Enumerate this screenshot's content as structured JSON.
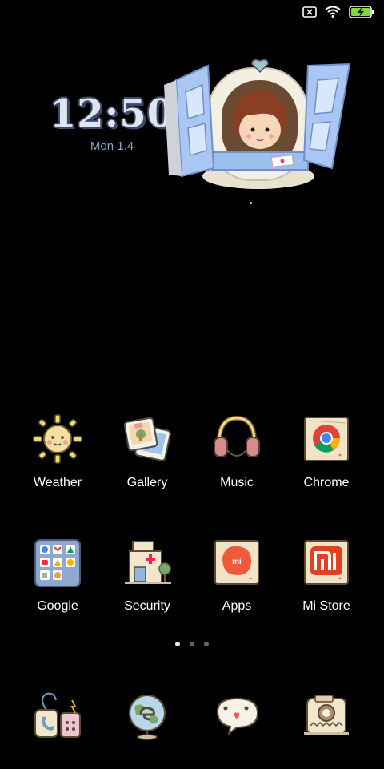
{
  "status_bar": {
    "icons": [
      "no-sim-icon",
      "wifi-icon",
      "battery-charging-icon"
    ],
    "battery_color": "#7ddc3c"
  },
  "clock_widget": {
    "time": "12:50",
    "date": "Mon 1.4"
  },
  "apps": [
    {
      "label": "Weather",
      "icon": "weather-sun-icon"
    },
    {
      "label": "Gallery",
      "icon": "gallery-photos-icon"
    },
    {
      "label": "Music",
      "icon": "headphones-icon"
    },
    {
      "label": "Chrome",
      "icon": "chrome-icon"
    },
    {
      "label": "Google",
      "icon": "google-folder-icon"
    },
    {
      "label": "Security",
      "icon": "security-hospital-icon"
    },
    {
      "label": "Apps",
      "icon": "apps-store-icon"
    },
    {
      "label": "Mi Store",
      "icon": "mi-store-icon"
    }
  ],
  "page_indicator": {
    "pages": 3,
    "active": 1
  },
  "dock": [
    {
      "icon": "phone-icon"
    },
    {
      "icon": "browser-globe-icon"
    },
    {
      "icon": "messages-icon"
    },
    {
      "icon": "camera-icon"
    }
  ]
}
